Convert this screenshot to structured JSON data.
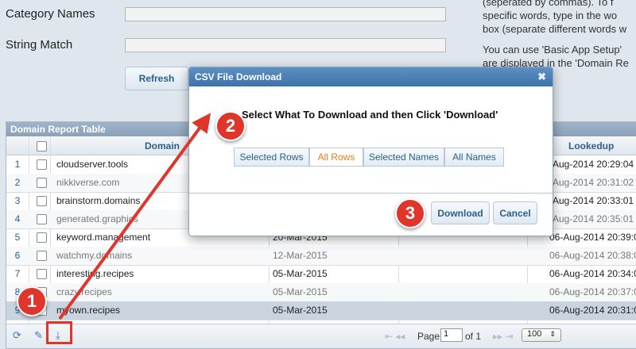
{
  "form": {
    "category_label": "Category Names",
    "string_label": "String Match",
    "refresh_label": "Refresh"
  },
  "help": {
    "lines": [
      "(seperated by commas). To f",
      "specific words, type in the wo",
      "box (separate different words w",
      "You can use 'Basic App Setup'",
      "are displayed in the 'Domain Re"
    ]
  },
  "table": {
    "title": "Domain Report Table",
    "col_domain": "Domain",
    "col_lookedup": "Lookedup",
    "rows": [
      {
        "num": "1",
        "domain": "cloudserver.tools",
        "date": "",
        "lookedup": "-Aug-2014 20:29:04"
      },
      {
        "num": "2",
        "domain": "nikkiverse.com",
        "date": "",
        "lookedup": "-Aug-2014 20:31:02"
      },
      {
        "num": "3",
        "domain": "brainstorm.domains",
        "date": "",
        "lookedup": "-Aug-2014 20:33:01"
      },
      {
        "num": "4",
        "domain": "generated.graphics",
        "date": "",
        "lookedup": "-Aug-2014 20:35:01"
      },
      {
        "num": "5",
        "domain": "keyword.management",
        "date": "20-Mar-2015",
        "lookedup": "06-Aug-2014 20:39:01"
      },
      {
        "num": "6",
        "domain": "watchmy.domains",
        "date": "12-Mar-2015",
        "lookedup": "06-Aug-2014 20:38:01"
      },
      {
        "num": "7",
        "domain": "interesting.recipes",
        "date": "05-Mar-2015",
        "lookedup": "06-Aug-2014 20:34:09"
      },
      {
        "num": "8",
        "domain": "crazy.recipes",
        "date": "05-Mar-2015",
        "lookedup": "06-Aug-2014 20:37:04"
      },
      {
        "num": "9",
        "domain": "myown.recipes",
        "date": "05-Mar-2015",
        "lookedup": "06-Aug-2014 20:31:02"
      }
    ],
    "footer": {
      "page_label": "Page",
      "page_value": "1",
      "of_label": "of 1",
      "page_size": "100"
    }
  },
  "modal": {
    "title": "CSV File Download",
    "close": "✖",
    "message": "Select What To Download and then Click 'Download'",
    "options": [
      "Selected Rows",
      "All Rows",
      "Selected Names",
      "All Names"
    ],
    "active_option": "All Rows",
    "download_label": "Download",
    "cancel_label": "Cancel"
  },
  "annotations": {
    "badge1": "1",
    "badge2": "2",
    "badge3": "3",
    "color": "#e0352b"
  },
  "icons": {
    "refresh": "refresh-icon",
    "wrench": "wrench-icon",
    "download": "download-icon"
  }
}
